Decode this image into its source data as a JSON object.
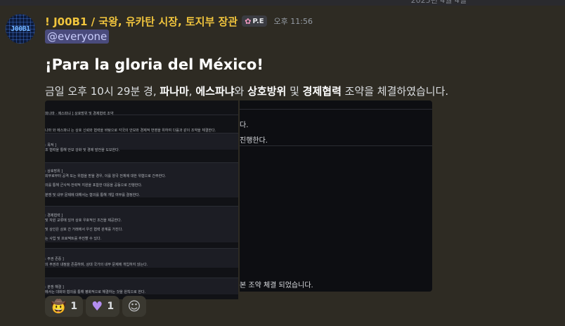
{
  "top_strip": {
    "date_fragment": "2025년 4월 4일"
  },
  "message": {
    "avatar_text": "J00B1",
    "username": "! J00B1 / 국왕, 유카탄 시장, 토지부 장관",
    "role_tag": "P.E",
    "role_icon": "flower-icon",
    "timestamp": "오후 11:56",
    "mention": "@everyone",
    "headline": "¡Para la gloria del México!",
    "body": {
      "part1": "금일 오후 10시 29분 경, ",
      "bold1": "파나마",
      "part2": ", ",
      "bold2": "에스파냐",
      "part3": "와 ",
      "bold3": "상호방위",
      "part4": " 및 ",
      "bold4": "경제협력",
      "part5": " 조약을 체결하였습니다."
    }
  },
  "doc_left": {
    "lines": [
      "파나마 · 에스파냐 ]  상호방위 및 경제협력 조약",
      "나마 와 에스파냐 는 상호 신뢰와 협력을 바탕으로 각국의 안보와 경제적 번영을 위하여 다음과 같이 조약을 체결한다.",
      ": 목적 ]",
      "조 협력을 통해 안보 강화 및 경제 발전을 도모한다.",
      ": 상호방위 ]",
      "외부로부터 공격 또는 위협을 받을 경우, 이를 양국 전체에 대한 위협으로 간주한다.",
      "의를 통해 군사적·전략적 지원을 포함한 대응을 공동으로 진행한다.",
      "분쟁 및 내부 문제에 대해서는 협의를 통해 개입 여부를 결정한다.",
      ": 경제협력 ]",
      "및 자원 교류에 있어 상호 우호적인 조건을 제공한다.",
      "및 상인은 상호 간 거래에서 우선 협력 관계를 가진다.",
      "는 사업 및 프로젝트를 추진할 수 있다.",
      ": 주권 존중 ]",
      "의 주권과 내정을 존중하며, 상대 국가의 내부 문제에 개입하지 않는다.",
      ": 분쟁 해결 ]",
      "에서는 대화와 협의를 통해 평화적으로 해결하는 것을 원칙으로 한다."
    ]
  },
  "doc_right": {
    "lines": [
      "다.",
      "진행한다.",
      "본 조약 체결 되었습니다."
    ]
  },
  "reactions": [
    {
      "emoji_name": "cowboy-face-icon",
      "count": "1"
    },
    {
      "emoji_name": "purple-heart-icon",
      "count": "1"
    }
  ],
  "add_reaction_icon": "add-reaction-icon"
}
